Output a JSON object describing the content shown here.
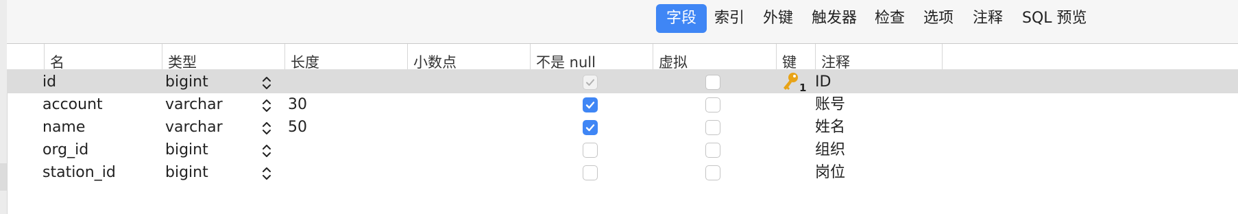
{
  "tabs": [
    {
      "label": "字段",
      "active": true
    },
    {
      "label": "索引",
      "active": false
    },
    {
      "label": "外键",
      "active": false
    },
    {
      "label": "触发器",
      "active": false
    },
    {
      "label": "检查",
      "active": false
    },
    {
      "label": "选项",
      "active": false
    },
    {
      "label": "注释",
      "active": false
    },
    {
      "label": "SQL 预览",
      "active": false
    }
  ],
  "columns": [
    "名",
    "类型",
    "长度",
    "小数点",
    "不是 null",
    "虚拟",
    "键",
    "注释"
  ],
  "rows": [
    {
      "name": "id",
      "type": "bigint",
      "length": "",
      "decimals": "",
      "not_null": "checked-disabled",
      "virtual": false,
      "key": "1",
      "comment": "ID",
      "selected": true
    },
    {
      "name": "account",
      "type": "varchar",
      "length": "30",
      "decimals": "",
      "not_null": "checked",
      "virtual": false,
      "key": "",
      "comment": "账号",
      "selected": false
    },
    {
      "name": "name",
      "type": "varchar",
      "length": "50",
      "decimals": "",
      "not_null": "checked",
      "virtual": false,
      "key": "",
      "comment": "姓名",
      "selected": false
    },
    {
      "name": "org_id",
      "type": "bigint",
      "length": "",
      "decimals": "",
      "not_null": "unchecked",
      "virtual": false,
      "key": "",
      "comment": "组织",
      "selected": false
    },
    {
      "name": "station_id",
      "type": "bigint",
      "length": "",
      "decimals": "",
      "not_null": "unchecked",
      "virtual": false,
      "key": "",
      "comment": "岗位",
      "selected": false
    }
  ],
  "colors": {
    "accent": "#3f86f5",
    "selection": "#dcdcdc",
    "key_gold": "#e8a317"
  }
}
